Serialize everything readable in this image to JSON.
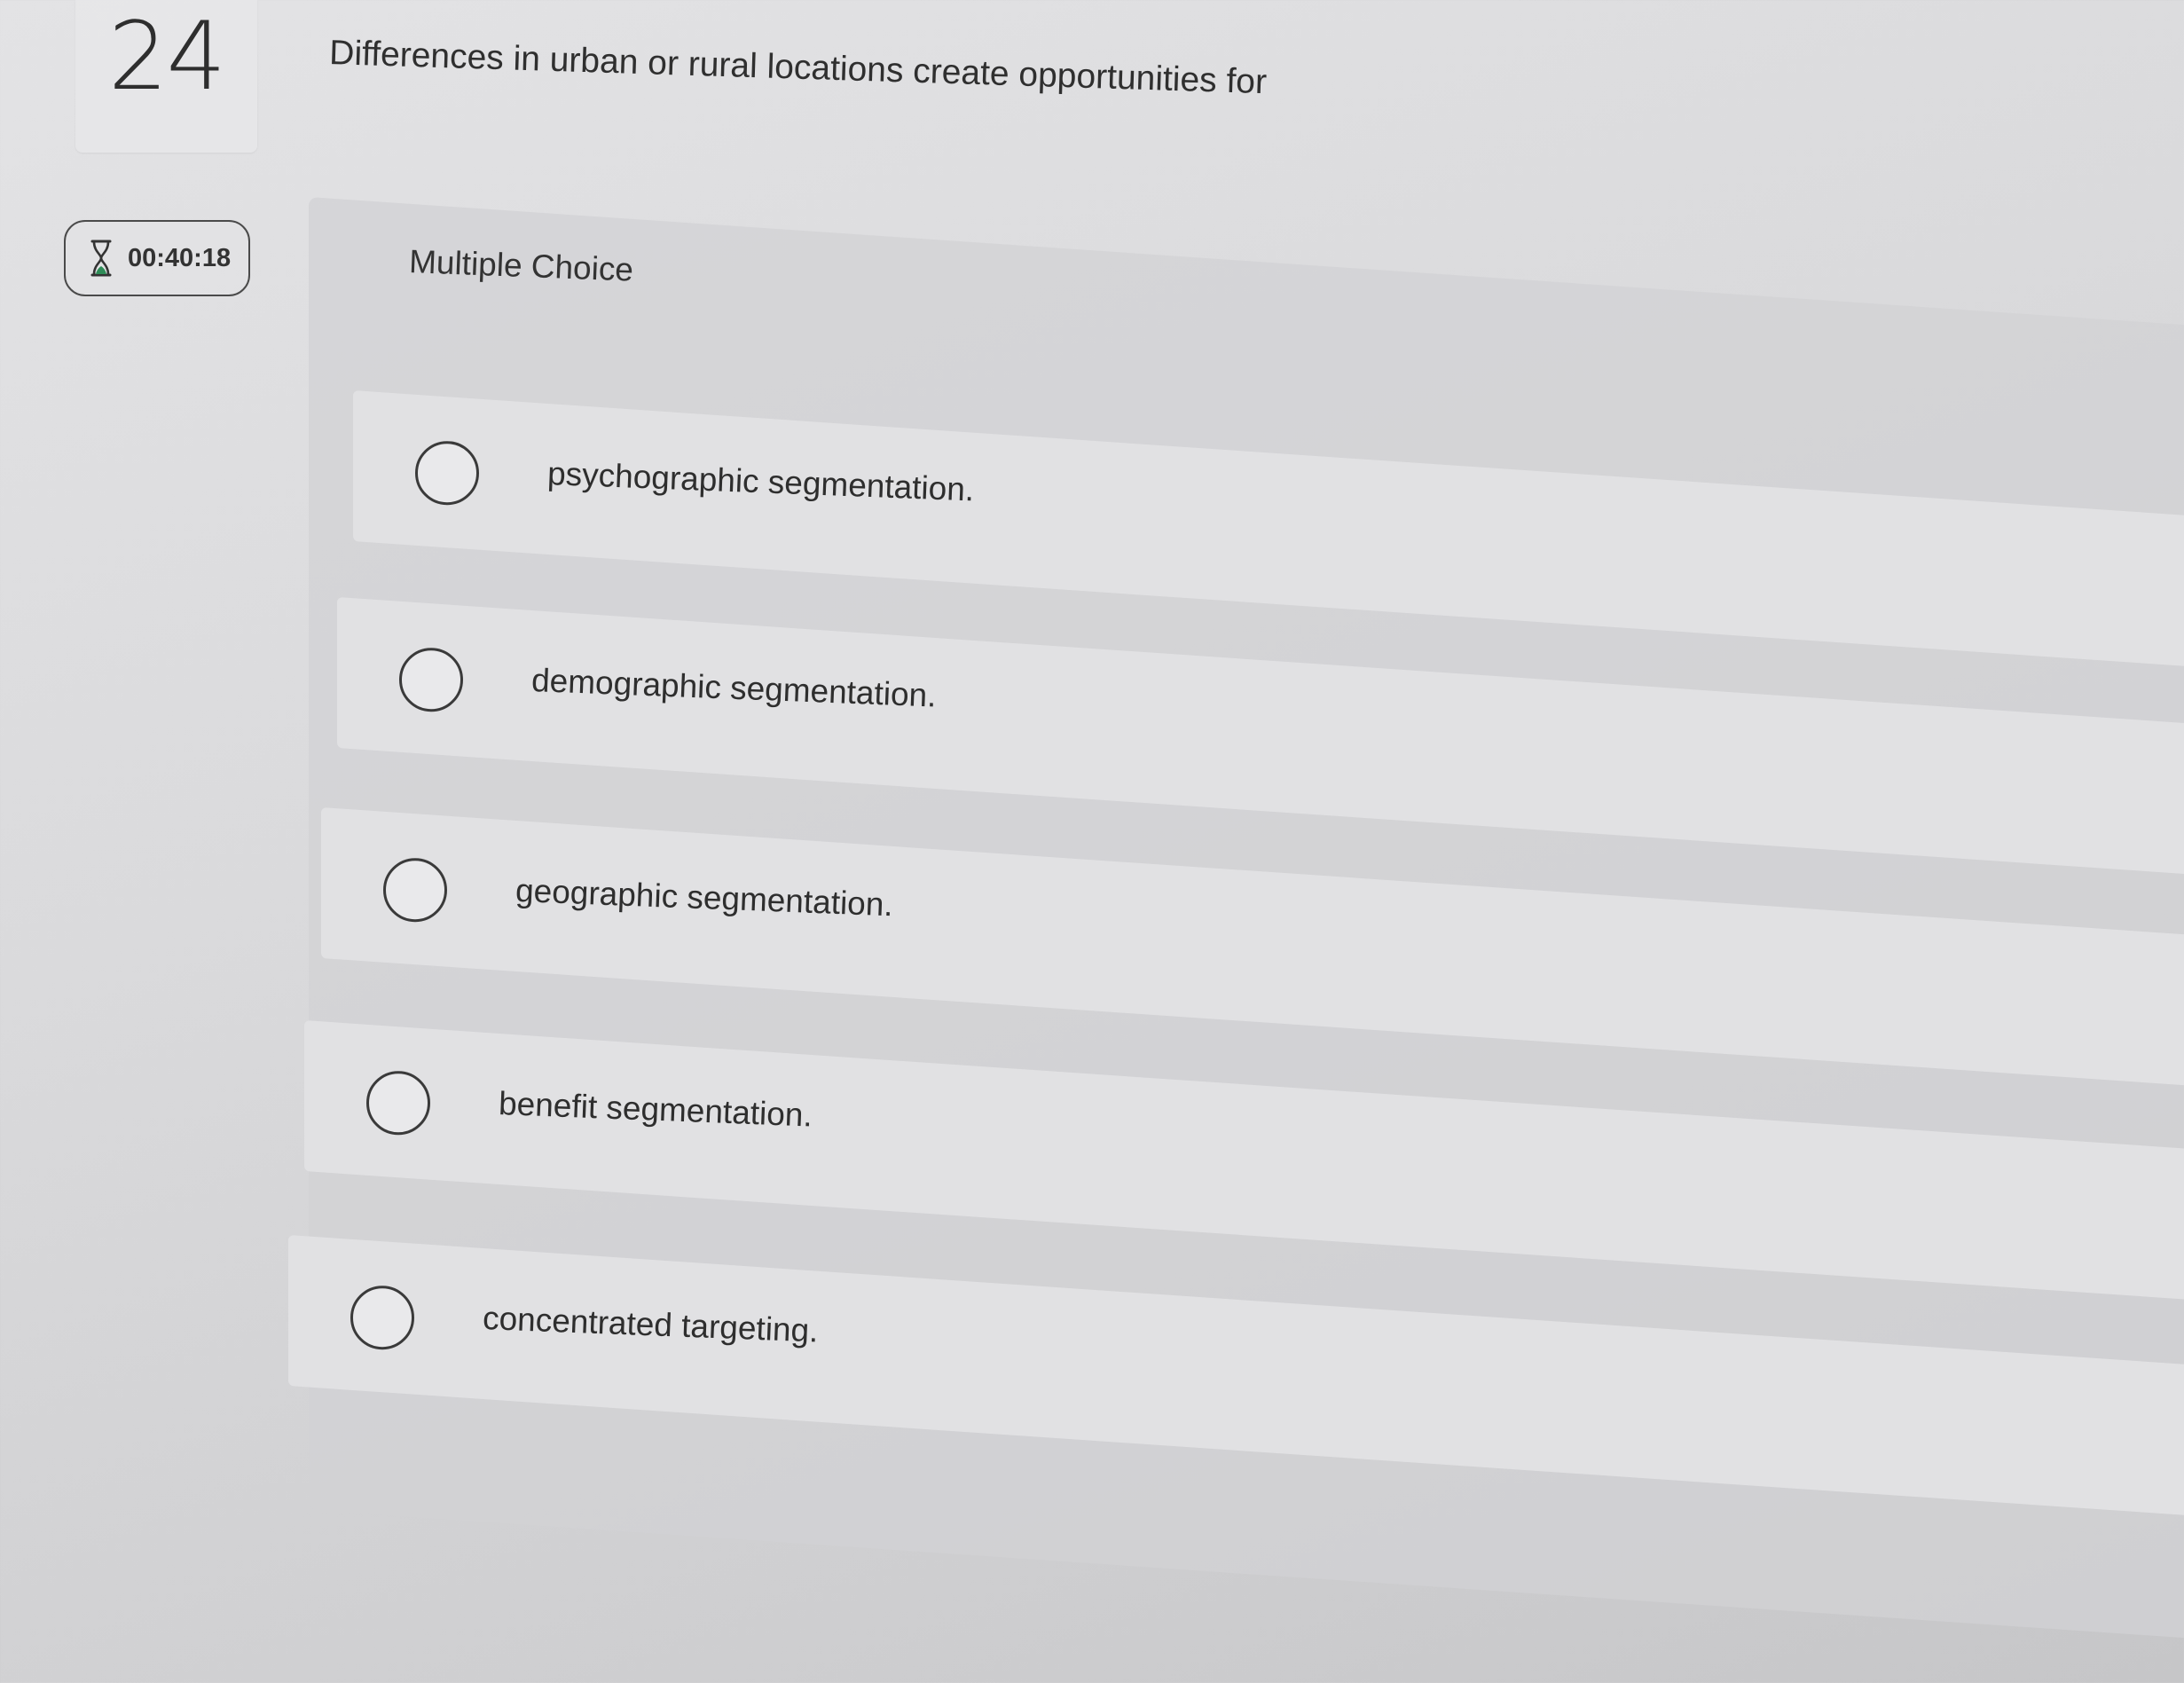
{
  "question": {
    "number": "24",
    "text": "Differences in urban or rural locations create opportunities for"
  },
  "timer": {
    "icon": "hourglass-icon",
    "value": "00:40:18"
  },
  "answer": {
    "type_label": "Multiple Choice",
    "options": [
      {
        "label": "psychographic segmentation.",
        "selected": false
      },
      {
        "label": "demographic segmentation.",
        "selected": false
      },
      {
        "label": "geographic segmentation.",
        "selected": false
      },
      {
        "label": "benefit segmentation.",
        "selected": false
      },
      {
        "label": "concentrated targeting.",
        "selected": false
      }
    ]
  },
  "colors": {
    "background": "#d8d8da",
    "option_background": "#e2e2e4",
    "text": "#2e2e2e",
    "timer_icon_accent": "#2e8b57"
  }
}
